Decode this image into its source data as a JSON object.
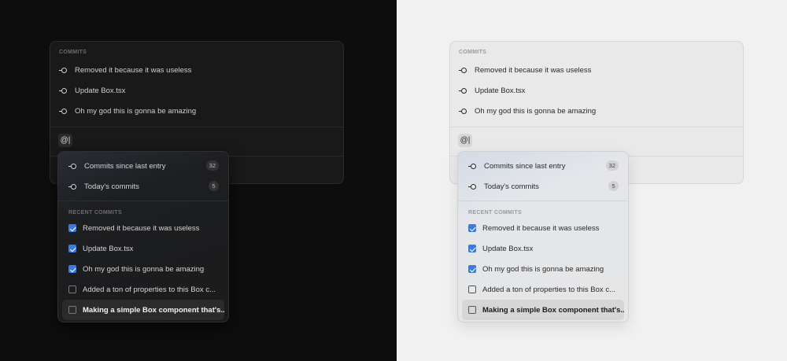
{
  "commits_panel": {
    "label": "COMMITS",
    "items": [
      "Removed it because it was useless",
      "Update Box.tsx",
      "Oh my god this is gonna be amazing"
    ],
    "input_value": "@|"
  },
  "dropdown": {
    "quick": [
      {
        "label": "Commits since last entry",
        "count": "32"
      },
      {
        "label": "Today's commits",
        "count": "5"
      }
    ],
    "recent_label": "RECENT COMMITS",
    "recent": [
      {
        "label": "Removed it because it was useless",
        "checked": true
      },
      {
        "label": "Update Box.tsx",
        "checked": true
      },
      {
        "label": "Oh my god this is gonna be amazing",
        "checked": true
      },
      {
        "label": "Added a ton of properties to this Box c...",
        "checked": false
      },
      {
        "label": "Making a simple Box component that's...",
        "checked": false,
        "highlighted": true
      }
    ]
  },
  "colors": {
    "accent": "#3a7be0",
    "dark_bg": "#0d0d0d",
    "light_bg": "#f1f1f1"
  }
}
